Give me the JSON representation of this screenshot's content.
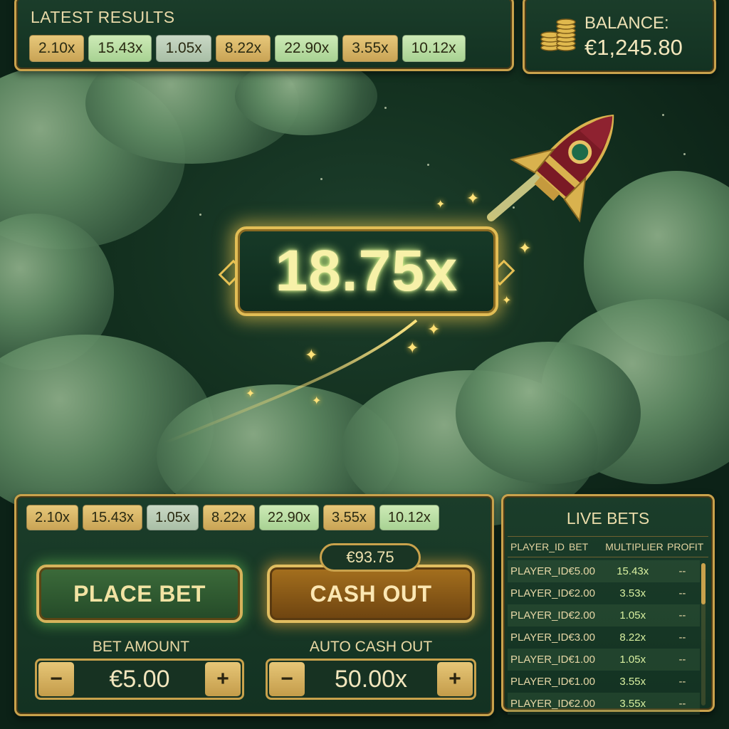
{
  "latest_results": {
    "title": "LATEST RESULTS",
    "chips": [
      {
        "value": "2.10x",
        "tone": "gold"
      },
      {
        "value": "15.43x",
        "tone": "green"
      },
      {
        "value": "1.05x",
        "tone": "grey"
      },
      {
        "value": "8.22x",
        "tone": "gold"
      },
      {
        "value": "22.90x",
        "tone": "green"
      },
      {
        "value": "3.55x",
        "tone": "gold"
      },
      {
        "value": "10.12x",
        "tone": "green"
      }
    ]
  },
  "balance": {
    "label": "BALANCE:",
    "value": "€1,245.80",
    "icon": "coins-icon"
  },
  "multiplier": {
    "value": "18.75x"
  },
  "controls": {
    "history_chips": [
      "2.10x",
      "15.43x",
      "1.05x",
      "8.22x",
      "22.90x",
      "3.55x",
      "10.12x"
    ],
    "place_bet_label": "PLACE BET",
    "cash_out_label": "CASH OUT",
    "cash_out_amount": "€93.75",
    "bet_amount_label": "BET AMOUNT",
    "bet_amount_value": "€5.00",
    "auto_cash_out_label": "AUTO CASH OUT",
    "auto_cash_out_value": "50.00x",
    "minus": "−",
    "plus": "+"
  },
  "live_bets": {
    "title": "LIVE BETS",
    "columns": [
      "PLAYER_ID",
      "BET",
      "MULTIPLIER",
      "PROFIT"
    ],
    "rows": [
      {
        "player": "PLAYER_ID",
        "bet": "€5.00",
        "multiplier": "15.43x",
        "profit": "--"
      },
      {
        "player": "PLAYER_ID",
        "bet": "€2.00",
        "multiplier": "3.53x",
        "profit": "--"
      },
      {
        "player": "PLAYER_ID",
        "bet": "€2.00",
        "multiplier": "1.05x",
        "profit": "--"
      },
      {
        "player": "PLAYER_ID",
        "bet": "€3.00",
        "multiplier": "8.22x",
        "profit": "--"
      },
      {
        "player": "PLAYER_ID",
        "bet": "€1.00",
        "multiplier": "1.05x",
        "profit": "--"
      },
      {
        "player": "PLAYER_ID",
        "bet": "€1.00",
        "multiplier": "3.55x",
        "profit": "--"
      },
      {
        "player": "PLAYER_ID",
        "bet": "€2.00",
        "multiplier": "3.55x",
        "profit": "--"
      }
    ]
  },
  "colors": {
    "accent_gold": "#c9a24c",
    "background": "#0f2a1d",
    "multiplier_glow": "#f7f1a8"
  }
}
